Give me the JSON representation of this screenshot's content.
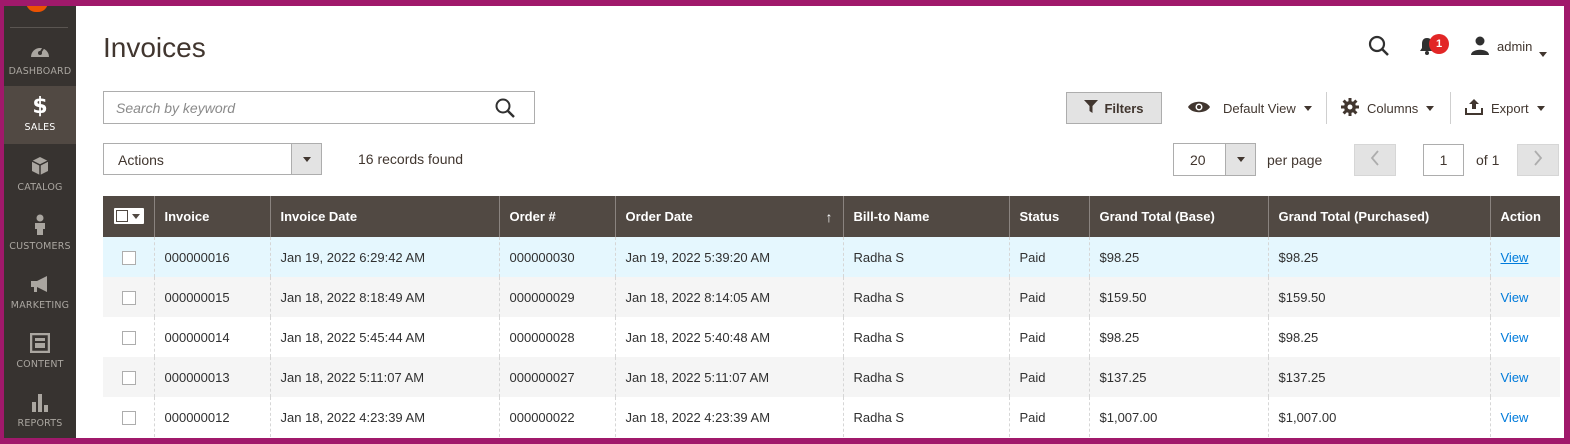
{
  "sidebar": {
    "items": [
      {
        "label": "DASHBOARD",
        "icon": "dashboard-icon"
      },
      {
        "label": "SALES",
        "icon": "dollar-icon"
      },
      {
        "label": "CATALOG",
        "icon": "cube-icon"
      },
      {
        "label": "CUSTOMERS",
        "icon": "person-icon"
      },
      {
        "label": "MARKETING",
        "icon": "megaphone-icon"
      },
      {
        "label": "CONTENT",
        "icon": "layout-icon"
      },
      {
        "label": "REPORTS",
        "icon": "bar-chart-icon"
      }
    ],
    "active": "SALES"
  },
  "header": {
    "title": "Invoices",
    "notifications_count": "1",
    "user_label": "admin"
  },
  "search": {
    "placeholder": "Search by keyword",
    "value": ""
  },
  "toolbar": {
    "filters_label": "Filters",
    "view_label": "Default View",
    "columns_label": "Columns",
    "export_label": "Export"
  },
  "actions": {
    "label": "Actions",
    "records_found": "16 records found"
  },
  "pagination": {
    "per_page_value": "20",
    "per_page_label": "per page",
    "current_page": "1",
    "of_label": "of 1"
  },
  "table": {
    "columns": [
      "Invoice",
      "Invoice Date",
      "Order #",
      "Order Date",
      "Bill-to Name",
      "Status",
      "Grand Total (Base)",
      "Grand Total (Purchased)",
      "Action"
    ],
    "sort_indicator": "↑",
    "rows": [
      {
        "invoice": "000000016",
        "invoice_date": "Jan 19, 2022 6:29:42 AM",
        "order": "000000030",
        "order_date": "Jan 19, 2022 5:39:20 AM",
        "bill_to": "Radha S",
        "status": "Paid",
        "total_base": "$98.25",
        "total_purchased": "$98.25",
        "action": "View"
      },
      {
        "invoice": "000000015",
        "invoice_date": "Jan 18, 2022 8:18:49 AM",
        "order": "000000029",
        "order_date": "Jan 18, 2022 8:14:05 AM",
        "bill_to": "Radha S",
        "status": "Paid",
        "total_base": "$159.50",
        "total_purchased": "$159.50",
        "action": "View"
      },
      {
        "invoice": "000000014",
        "invoice_date": "Jan 18, 2022 5:45:44 AM",
        "order": "000000028",
        "order_date": "Jan 18, 2022 5:40:48 AM",
        "bill_to": "Radha S",
        "status": "Paid",
        "total_base": "$98.25",
        "total_purchased": "$98.25",
        "action": "View"
      },
      {
        "invoice": "000000013",
        "invoice_date": "Jan 18, 2022 5:11:07 AM",
        "order": "000000027",
        "order_date": "Jan 18, 2022 5:11:07 AM",
        "bill_to": "Radha S",
        "status": "Paid",
        "total_base": "$137.25",
        "total_purchased": "$137.25",
        "action": "View"
      },
      {
        "invoice": "000000012",
        "invoice_date": "Jan 18, 2022 4:23:39 AM",
        "order": "000000022",
        "order_date": "Jan 18, 2022 4:23:39 AM",
        "bill_to": "Radha S",
        "status": "Paid",
        "total_base": "$1,007.00",
        "total_purchased": "$1,007.00",
        "action": "View"
      }
    ]
  },
  "colors": {
    "frame": "#a0196b",
    "sidebar": "#373330",
    "sidebar_active": "#514943",
    "header_row": "#514943",
    "link": "#007bdb",
    "badge": "#e22626"
  }
}
